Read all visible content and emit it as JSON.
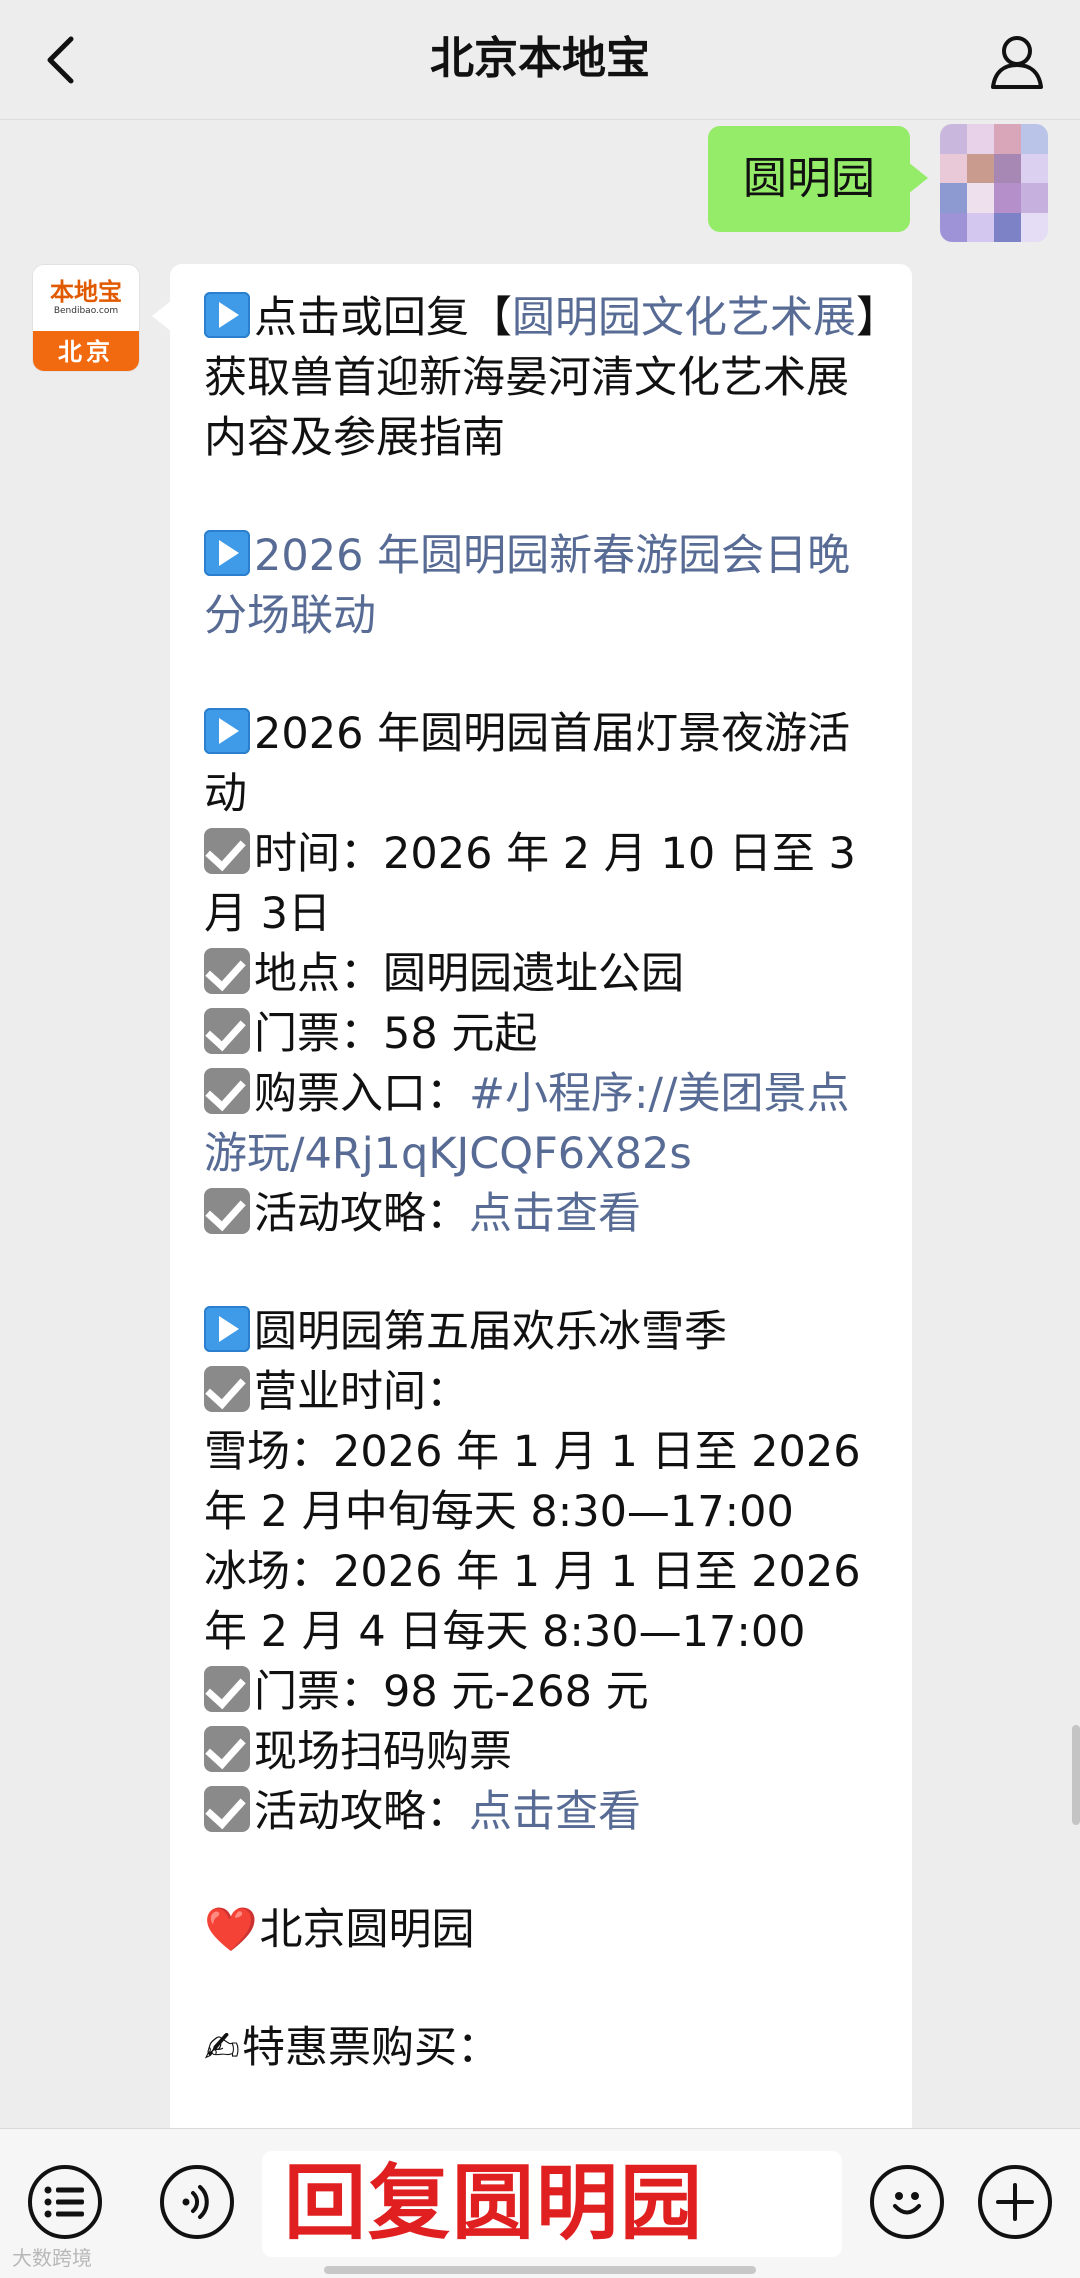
{
  "header": {
    "title": "北京本地宝",
    "back_icon": "chevron-left-icon",
    "profile_icon": "person-icon"
  },
  "sent_message": {
    "text": "圆明园"
  },
  "bot_avatar": {
    "logo_text": "本地宝",
    "logo_sub": "Bendibao.com",
    "city": "北京"
  },
  "reply": {
    "item1_pre": "点击或回复【",
    "item1_link": "圆明园文化艺术展",
    "item1_post": "】获取兽首迎新海晏河清文化艺术展内容及参展指南",
    "item2_link": "2026 年圆明园新春游园会日晚分场联动",
    "item3_title": "2026 年圆明园首届灯景夜游活动",
    "item3_time": "时间：2026 年 2 月 10 日至 3 月 3日",
    "item3_place": "地点：圆明园遗址公园",
    "item3_ticket": "门票：58 元起",
    "item3_buy_label": "购票入口：",
    "item3_buy_link": "#小程序://美团景点游玩/4Rj1qKJCQF6X82s",
    "item3_guide_label": "活动攻略：",
    "item3_guide_link": "点击查看",
    "item4_title": "圆明园第五届欢乐冰雪季",
    "item4_hours_label": "营业时间：",
    "item4_snow": "雪场：2026 年 1 月 1 日至 2026 年 2 月中旬每天 8:30—17:00",
    "item4_ice": "冰场：2026 年 1 月 1 日至 2026 年 2 月 4 日每天 8:30—17:00",
    "item4_ticket": "门票：98 元-268 元",
    "item4_onsite": "现场扫码购票",
    "item4_guide_label": "活动攻略：",
    "item4_guide_link": "点击查看",
    "item5_heart": "❤️",
    "item5_title": "北京圆明园",
    "item6_pen": "✍",
    "item6_title": "特惠票购买："
  },
  "input_bar": {
    "menu_icon": "list-menu-icon",
    "voice_icon": "voice-icon",
    "input_value": "回复圆明园",
    "emoji_icon": "smiley-icon",
    "plus_icon": "plus-icon"
  },
  "watermark": "大数跨境",
  "colors": {
    "sent_bubble": "#95ec69",
    "link": "#576b95",
    "input_text": "#e02020",
    "bot_orange": "#f26a10"
  }
}
